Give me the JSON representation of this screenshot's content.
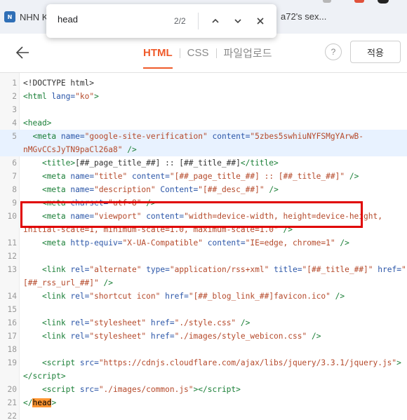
{
  "browser": {
    "tab1_title": "NHN K",
    "tab2_title": "a72's sex..."
  },
  "find": {
    "query": "head",
    "count": "2/2"
  },
  "editor": {
    "tabs": [
      "HTML",
      "CSS",
      "파일업로드"
    ],
    "help_label": "?",
    "apply_label": "적용"
  },
  "code_lines": [
    {
      "n": "1",
      "html": "&lt;!DOCTYPE html&gt;"
    },
    {
      "n": "2",
      "html": "<span class='t'>&lt;html</span> <span class='a'>lang=</span><span class='s'>\"ko\"</span><span class='t'>&gt;</span>"
    },
    {
      "n": "3",
      "html": ""
    },
    {
      "n": "4",
      "html": "<span class='t'>&lt;head&gt;</span>"
    },
    {
      "n": "5",
      "html": "  <span class='t'>&lt;meta</span> <span class='a'>name=</span><span class='s'>\"google-site-verification\"</span> <span class='a'>content=</span><span class='s'>\"5zbes5swhiuNYFSMgYArwB-</span>"
    },
    {
      "n": "",
      "html": "<span class='s'>nMGvCCsJyTN9paCl26a8\"</span> <span class='t'>/&gt;</span>"
    },
    {
      "n": "6",
      "html": "    <span class='t'>&lt;title&gt;</span>[##_page_title_##] :: [##_title_##]<span class='t'>&lt;/title&gt;</span>"
    },
    {
      "n": "7",
      "html": "    <span class='t'>&lt;meta</span> <span class='a'>name=</span><span class='s'>\"title\"</span> <span class='a'>content=</span><span class='s'>\"[##_page_title_##] :: [##_title_##]\"</span> <span class='t'>/&gt;</span>"
    },
    {
      "n": "8",
      "html": "    <span class='t'>&lt;meta</span> <span class='a'>name=</span><span class='s'>\"description\"</span> <span class='a'>Content=</span><span class='s'>\"[##_desc_##]\"</span> <span class='t'>/&gt;</span>"
    },
    {
      "n": "9",
      "html": "    <span class='t'>&lt;meta</span> <span class='a'>charset=</span><span class='s'>\"utf-8\"</span> <span class='t'>/&gt;</span>"
    },
    {
      "n": "10",
      "html": "    <span class='t'>&lt;meta</span> <span class='a'>name=</span><span class='s'>\"viewport\"</span> <span class='a'>content=</span><span class='s'>\"width=device-width, height=device-height,</span>"
    },
    {
      "n": "",
      "html": "<span class='s'>initial-scale=1, minimum-scale=1.0, maximum-scale=1.0\"</span> <span class='t'>/&gt;</span>"
    },
    {
      "n": "11",
      "html": "    <span class='t'>&lt;meta</span> <span class='a'>http-equiv=</span><span class='s'>\"X-UA-Compatible\"</span> <span class='a'>content=</span><span class='s'>\"IE=edge, chrome=1\"</span> <span class='t'>/&gt;</span>"
    },
    {
      "n": "12",
      "html": ""
    },
    {
      "n": "13",
      "html": "    <span class='t'>&lt;link</span> <span class='a'>rel=</span><span class='s'>\"alternate\"</span> <span class='a'>type=</span><span class='s'>\"application/rss+xml\"</span> <span class='a'>title=</span><span class='s'>\"[##_title_##]\"</span> <span class='a'>href=</span><span class='s'>\"</span>"
    },
    {
      "n": "",
      "html": "<span class='s'>[##_rss_url_##]\"</span> <span class='t'>/&gt;</span>"
    },
    {
      "n": "14",
      "html": "    <span class='t'>&lt;link</span> <span class='a'>rel=</span><span class='s'>\"shortcut icon\"</span> <span class='a'>href=</span><span class='s'>\"[##_blog_link_##]favicon.ico\"</span> <span class='t'>/&gt;</span>"
    },
    {
      "n": "15",
      "html": ""
    },
    {
      "n": "16",
      "html": "    <span class='t'>&lt;link</span> <span class='a'>rel=</span><span class='s'>\"stylesheet\"</span> <span class='a'>href=</span><span class='s'>\"./style.css\"</span> <span class='t'>/&gt;</span>"
    },
    {
      "n": "17",
      "html": "    <span class='t'>&lt;link</span> <span class='a'>rel=</span><span class='s'>\"stylesheet\"</span> <span class='a'>href=</span><span class='s'>\"./images/style_webicon.css\"</span> <span class='t'>/&gt;</span>"
    },
    {
      "n": "18",
      "html": ""
    },
    {
      "n": "19",
      "html": "    <span class='t'>&lt;script</span> <span class='a'>src=</span><span class='s'>\"https://cdnjs.cloudflare.com/ajax/libs/jquery/3.3.1/jquery.js\"</span><span class='t'>&gt;</span>"
    },
    {
      "n": "",
      "html": "<span class='t'>&lt;/script&gt;</span>"
    },
    {
      "n": "20",
      "html": "    <span class='t'>&lt;script</span> <span class='a'>src=</span><span class='s'>\"./images/common.js\"</span><span class='t'>&gt;&lt;/script&gt;</span>"
    },
    {
      "n": "21",
      "html": "<span class='t'>&lt;/</span><span class='hl-match'>head</span><span class='t'>&gt;</span>"
    },
    {
      "n": "22",
      "html": ""
    }
  ],
  "colors": {
    "accent": "#ef5a2a",
    "highlight_box": "#e00000",
    "tag": "#1a7f37",
    "attr": "#2b56a8",
    "string": "#b5492a"
  }
}
